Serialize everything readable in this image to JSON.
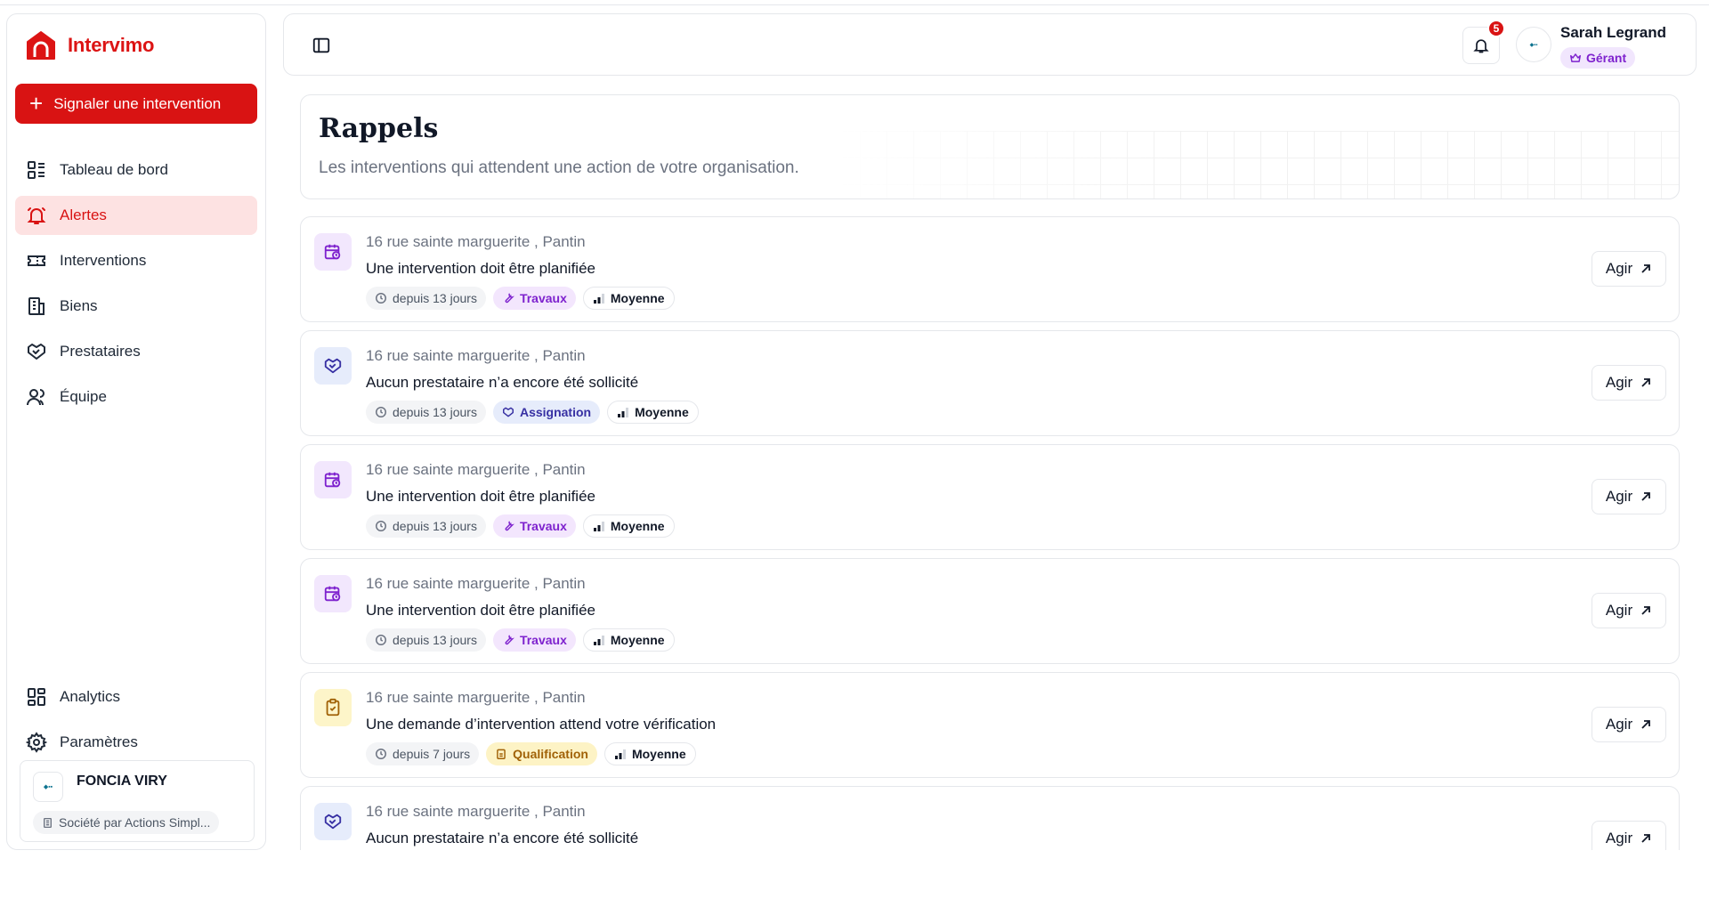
{
  "brand": {
    "name": "Intervimo",
    "color": "#dc1414"
  },
  "sidebar": {
    "cta_label": "Signaler une intervention",
    "items": [
      {
        "label": "Tableau de bord",
        "icon": "dashboard-icon",
        "active": false
      },
      {
        "label": "Alertes",
        "icon": "alarm-bell-icon",
        "active": true
      },
      {
        "label": "Interventions",
        "icon": "ticket-icon",
        "active": false
      },
      {
        "label": "Biens",
        "icon": "building-icon",
        "active": false
      },
      {
        "label": "Prestataires",
        "icon": "handshake-icon",
        "active": false
      },
      {
        "label": "Équipe",
        "icon": "users-icon",
        "active": false
      }
    ],
    "bottom_items": [
      {
        "label": "Analytics",
        "icon": "grid-icon"
      },
      {
        "label": "Paramètres",
        "icon": "gear-icon"
      }
    ],
    "org": {
      "name": "FONCIA VIRY",
      "type": "Société par Actions Simpl..."
    }
  },
  "header": {
    "notifications_count": "5",
    "user_name": "Sarah Legrand",
    "user_role": "Gérant"
  },
  "page": {
    "title": "Rappels",
    "subtitle": "Les interventions qui attendent une action de votre organisation."
  },
  "reminders": [
    {
      "kind": "planif",
      "address": "16 rue sainte marguerite , Pantin",
      "title": "Une intervention doit être planifiée",
      "since": "depuis 13 jours",
      "category": "Travaux",
      "priority": "Moyenne",
      "action": "Agir"
    },
    {
      "kind": "assign",
      "address": "16 rue sainte marguerite , Pantin",
      "title": "Aucun prestataire n’a encore été sollicité",
      "since": "depuis 13 jours",
      "category": "Assignation",
      "priority": "Moyenne",
      "action": "Agir"
    },
    {
      "kind": "planif",
      "address": "16 rue sainte marguerite , Pantin",
      "title": "Une intervention doit être planifiée",
      "since": "depuis 13 jours",
      "category": "Travaux",
      "priority": "Moyenne",
      "action": "Agir"
    },
    {
      "kind": "planif",
      "address": "16 rue sainte marguerite , Pantin",
      "title": "Une intervention doit être planifiée",
      "since": "depuis 13 jours",
      "category": "Travaux",
      "priority": "Moyenne",
      "action": "Agir"
    },
    {
      "kind": "qualif",
      "address": "16 rue sainte marguerite , Pantin",
      "title": "Une demande d’intervention attend votre vérification",
      "since": "depuis 7 jours",
      "category": "Qualification",
      "priority": "Moyenne",
      "action": "Agir"
    },
    {
      "kind": "assign",
      "address": "16 rue sainte marguerite , Pantin",
      "title": "Aucun prestataire n’a encore été sollicité",
      "since": "",
      "category": "",
      "priority": "",
      "action": "Agir"
    }
  ]
}
